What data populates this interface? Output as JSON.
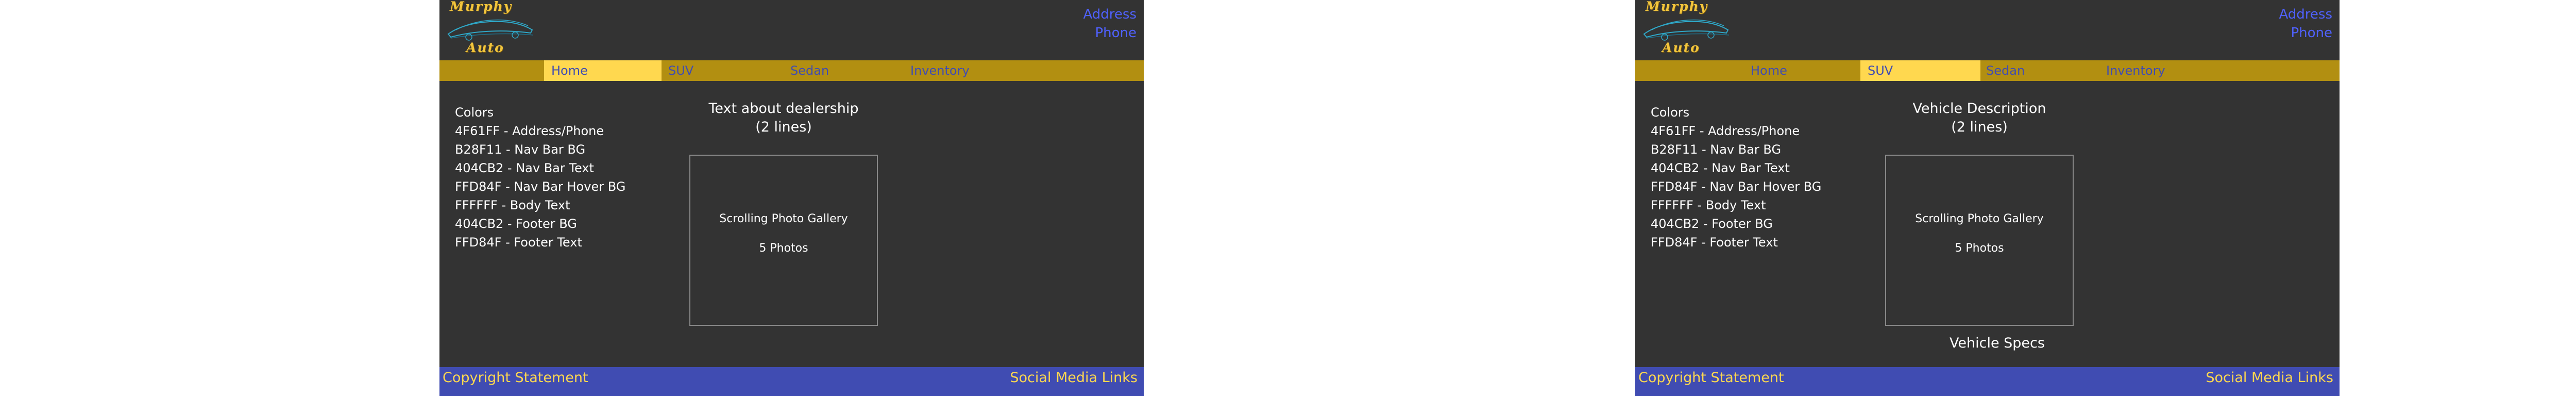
{
  "logo": {
    "line1": "Murphy",
    "line2": "Auto"
  },
  "header": {
    "address": "Address",
    "phone": "Phone"
  },
  "nav": {
    "items": [
      "Home",
      "SUV",
      "Sedan",
      "Inventory"
    ]
  },
  "colors_panel": {
    "title": "Colors",
    "items": [
      "4F61FF - Address/Phone",
      "B28F11 - Nav Bar BG",
      "404CB2 - Nav Bar Text",
      "FFD84F - Nav Bar Hover BG",
      "FFFFFF - Body Text",
      "404CB2 - Footer BG",
      "FFD84F - Footer Text"
    ]
  },
  "pages": [
    {
      "active_nav": "Home",
      "title_line1": "Text about dealership",
      "title_line2": "(2 lines)",
      "gallery_line1": "Scrolling Photo Gallery",
      "gallery_line2": "5 Photos"
    },
    {
      "active_nav": "SUV",
      "title_line1": "Vehicle Description",
      "title_line2": "(2 lines)",
      "gallery_line1": "Scrolling Photo Gallery",
      "gallery_line2": "5 Photos",
      "specs": "Vehicle Specs"
    }
  ],
  "footer": {
    "copyright": "Copyright Statement",
    "social": "Social Media Links"
  },
  "palette": {
    "address_phone": "#4F61FF",
    "nav_bg": "#B28F11",
    "nav_text": "#404CB2",
    "nav_hover_bg": "#FFD84F",
    "body_text": "#FFFFFF",
    "footer_bg": "#404CB2",
    "footer_text": "#FFD84F",
    "page_bg": "#333333"
  }
}
